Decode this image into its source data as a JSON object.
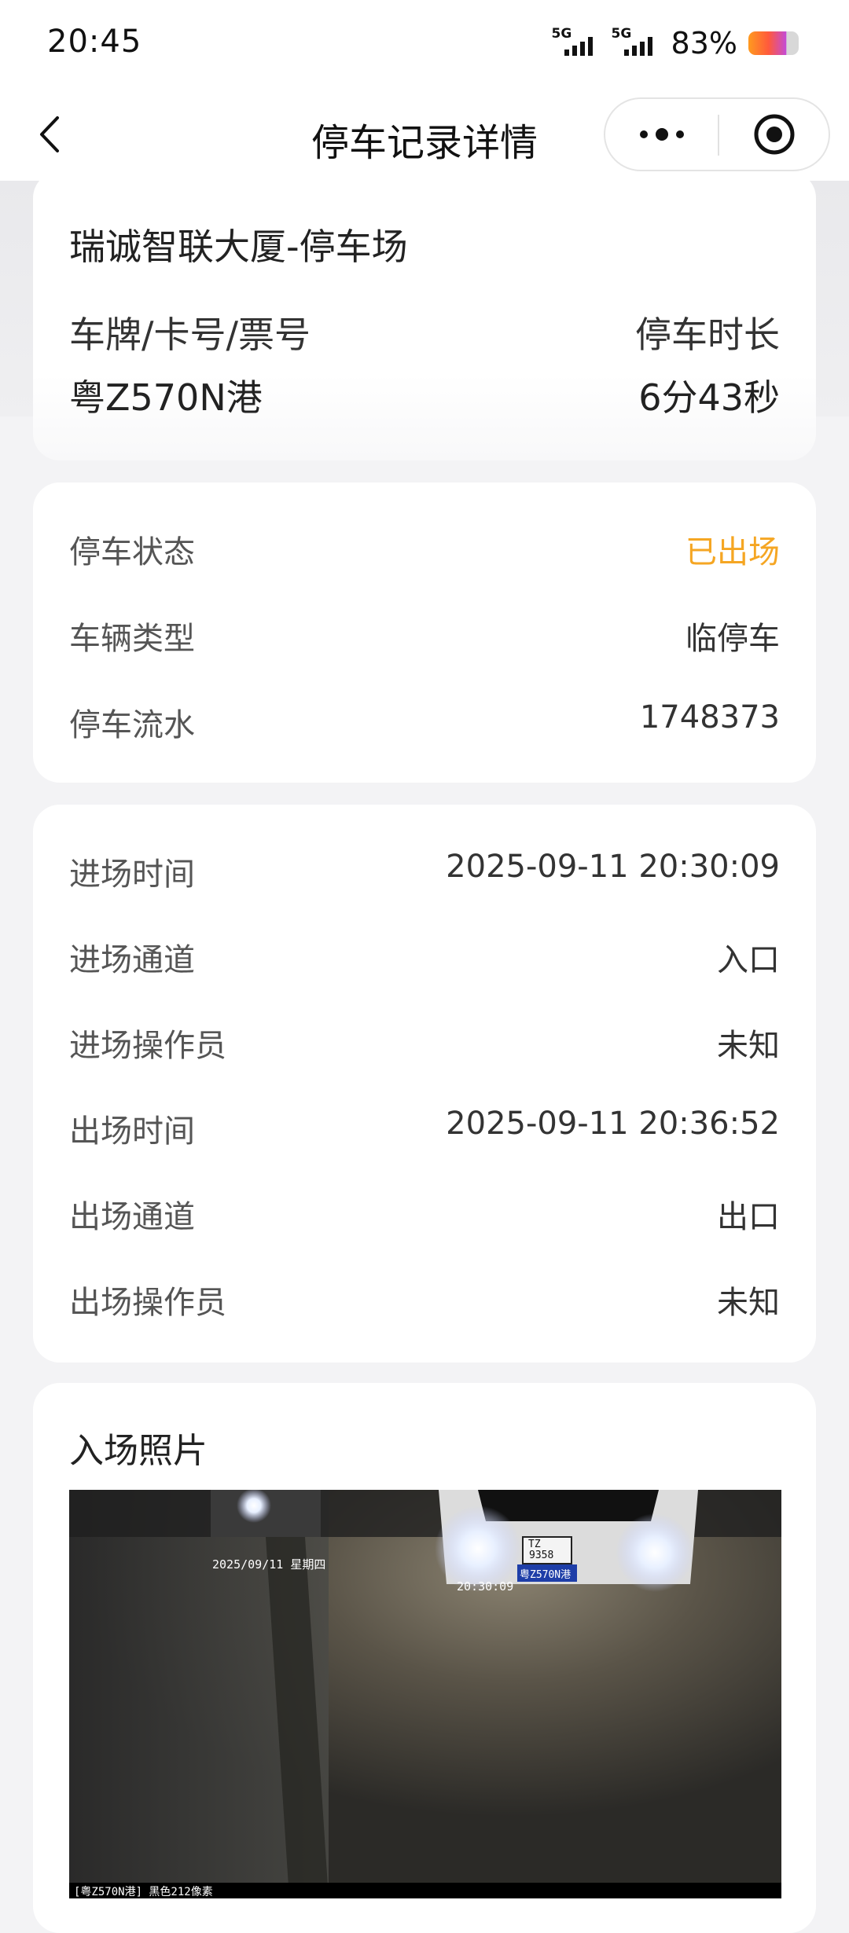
{
  "status_bar": {
    "time": "20:45",
    "signal1_tag": "5G",
    "signal2_tag": "5G",
    "battery_percent": "83%"
  },
  "navbar": {
    "title": "停车记录详情",
    "back_icon": "chevron-left-icon",
    "more_icon": "more-dots-icon",
    "target_icon": "target-circle-icon"
  },
  "summary": {
    "parking_lot": "瑞诚智联大厦-停车场",
    "plate_label": "车牌/卡号/票号",
    "duration_label": "停车时长",
    "plate_value": "粤Z570N港",
    "duration_value": "6分43秒"
  },
  "status_card": {
    "rows": [
      {
        "label": "停车状态",
        "value": "已出场"
      },
      {
        "label": "车辆类型",
        "value": "临停车"
      },
      {
        "label": "停车流水",
        "value": "1748373"
      }
    ],
    "status_color": "#f5a623"
  },
  "time_card": {
    "rows": [
      {
        "label": "进场时间",
        "value": "2025-09-11 20:30:09"
      },
      {
        "label": "进场通道",
        "value": "入口"
      },
      {
        "label": "进场操作员",
        "value": "未知"
      },
      {
        "label": "出场时间",
        "value": "2025-09-11 20:36:52"
      },
      {
        "label": "出场通道",
        "value": "出口"
      },
      {
        "label": "出场操作员",
        "value": "未知"
      }
    ]
  },
  "photo_card": {
    "title": "入场照片",
    "overlay_date": "2025/09/11 星期四",
    "overlay_time": "20:30:09",
    "plate_line1": "TZ",
    "plate_line2": "9358",
    "plate_line3": "粤Z570N港",
    "caption": "[粤Z570N港] 黑色212像素"
  }
}
